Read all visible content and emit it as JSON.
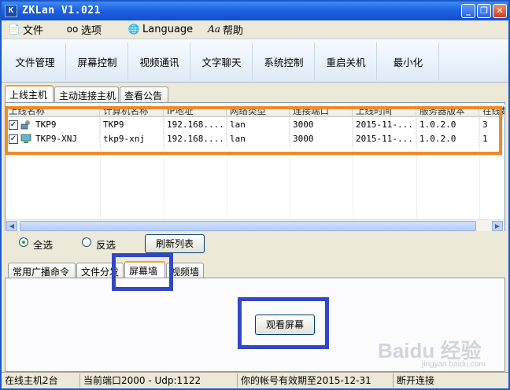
{
  "window": {
    "title": "ZKLan V1.021",
    "icon_letter": "K"
  },
  "title_buttons": {
    "minimize": "_",
    "restore": "❐",
    "close": "✕"
  },
  "menu": [
    {
      "label": "文件",
      "icon": "file-icon"
    },
    {
      "label": "选项",
      "icon": "glasses-icon"
    },
    {
      "label": "Language",
      "icon": "language-icon"
    },
    {
      "label": "帮助",
      "icon": "help-icon"
    }
  ],
  "toolbar": [
    "文件管理",
    "屏幕控制",
    "视频通讯",
    "文字聊天",
    "系统控制",
    "重启关机",
    "最小化"
  ],
  "top_tabs": [
    "上线主机",
    "主动连接主机",
    "查看公告"
  ],
  "grid": {
    "columns": [
      "上线名称",
      "计算机名称",
      "IP地址",
      "网络类型",
      "连接端口",
      "上线时间",
      "服务器版本",
      "在线数"
    ],
    "rows": [
      {
        "checked": true,
        "icon": "computer-user-icon",
        "name": "TKP9",
        "computer": "TKP9",
        "ip": "192.168....",
        "net": "lan",
        "port": "3000",
        "time": "2015-11-...",
        "version": "1.0.2.0",
        "count": "3"
      },
      {
        "checked": true,
        "icon": "computer-icon",
        "name": "TKP9-XNJ",
        "computer": "tkp9-xnj",
        "ip": "192.168....",
        "net": "lan",
        "port": "3000",
        "time": "2015-11-...",
        "version": "1.0.2.0",
        "count": "1"
      }
    ]
  },
  "selection": {
    "select_all": "全选",
    "invert": "反选",
    "refresh": "刷新列表",
    "selected": "select_all"
  },
  "bottom_tabs": [
    "常用广播命令",
    "文件分发",
    "屏幕墙",
    "视频墙"
  ],
  "panel": {
    "view_button": "观看屏幕"
  },
  "status": [
    "在线主机2台",
    "当前端口2000 - Udp:1122",
    "你的帐号有效期至2015-12-31",
    "断开连接"
  ],
  "watermark": {
    "text": "Baidu 经验",
    "sub": "jingyan.baidu.com"
  },
  "colors": {
    "title_bar": "#1f62e0",
    "highlight_orange": "#f08a2a",
    "highlight_blue": "#3347c4",
    "active_tab_border": "#f0a030"
  }
}
